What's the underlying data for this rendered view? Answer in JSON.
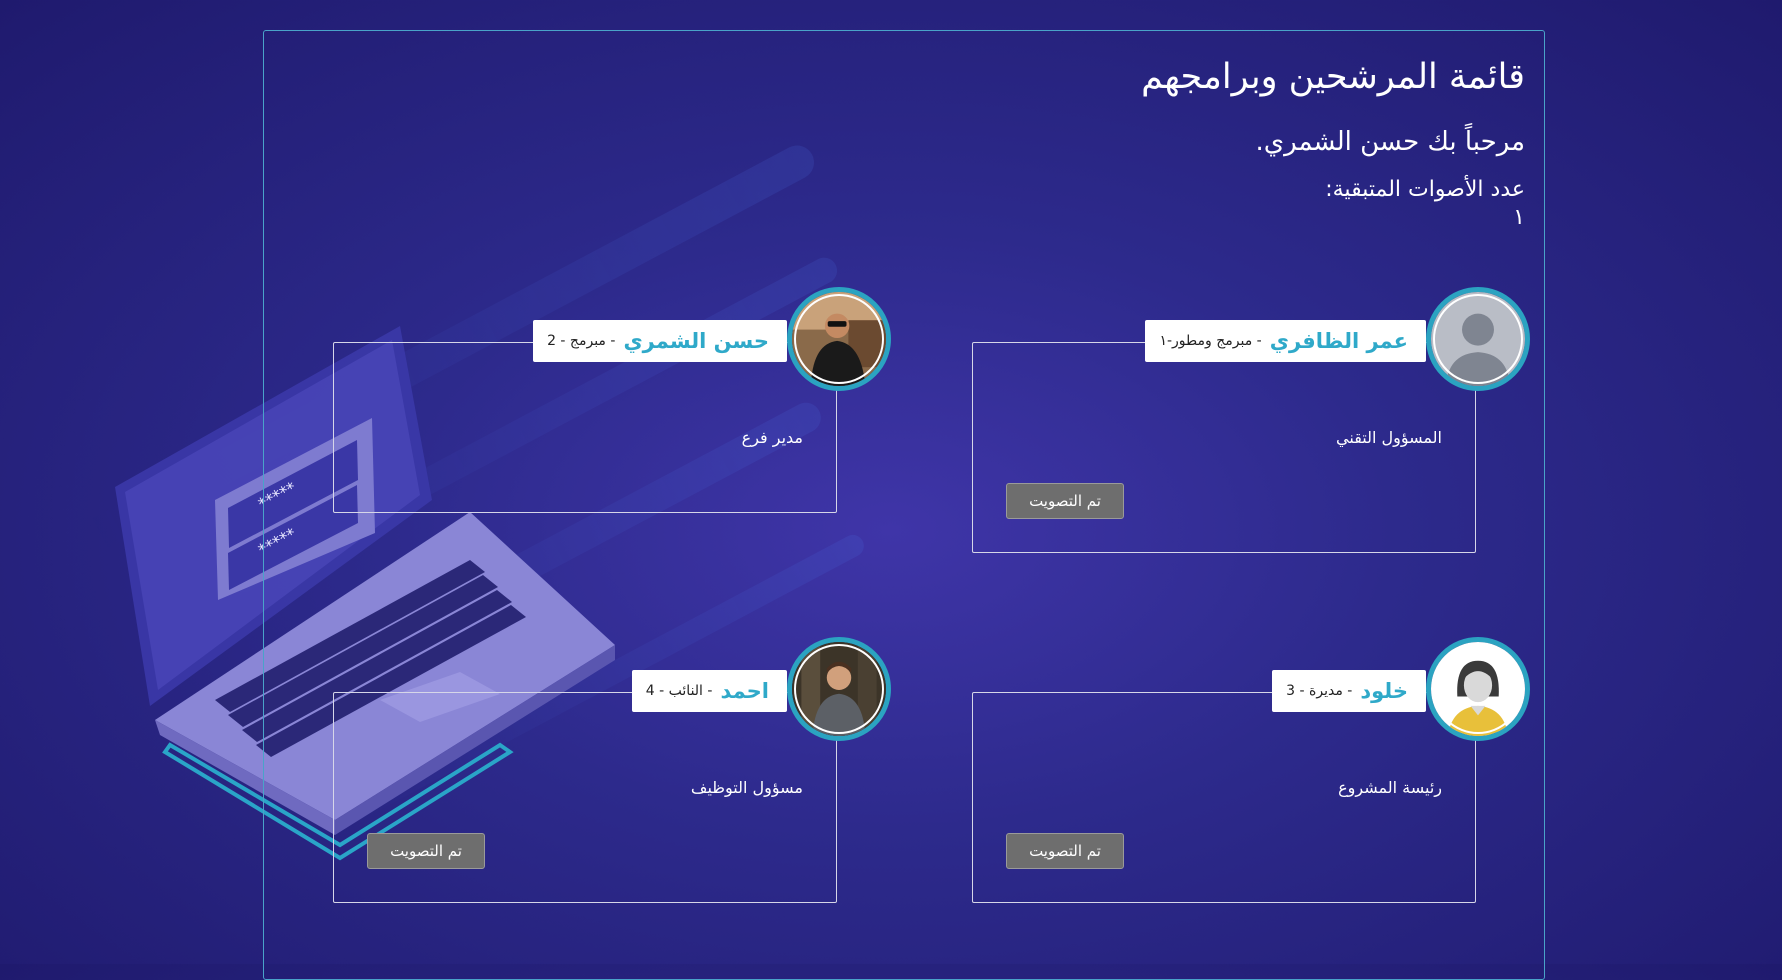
{
  "page": {
    "title": "قائمة المرشحين وبرامجهم",
    "welcome": "مرحباً بك حسن الشمري.",
    "votes_remaining_label": "عدد الأصوات المتبقية:",
    "votes_remaining_value": "١"
  },
  "candidates": [
    {
      "name": "عمر الظافري",
      "subtitle": "- مبرمج ومطور-١",
      "role": "المسؤول التقني",
      "button": "تم التصويت",
      "avatar": "person-silhouette-icon"
    },
    {
      "name": "حسن الشمري",
      "subtitle": "- مبرمج - 2",
      "role": "مدير فرع",
      "button": "",
      "avatar": "photo-man-sunglasses"
    },
    {
      "name": "خلود",
      "subtitle": "- مديرة - 3",
      "role": "رئيسة المشروع",
      "button": "تم التصويت",
      "avatar": "woman-avatar-icon"
    },
    {
      "name": "احمد",
      "subtitle": "- النائب - 4",
      "role": "مسؤول التوظيف",
      "button": "تم التصويت",
      "avatar": "photo-young-man"
    }
  ],
  "colors": {
    "accent": "#2fa9c9",
    "background": "#2d2a8c",
    "button": "#6e6e6e"
  }
}
